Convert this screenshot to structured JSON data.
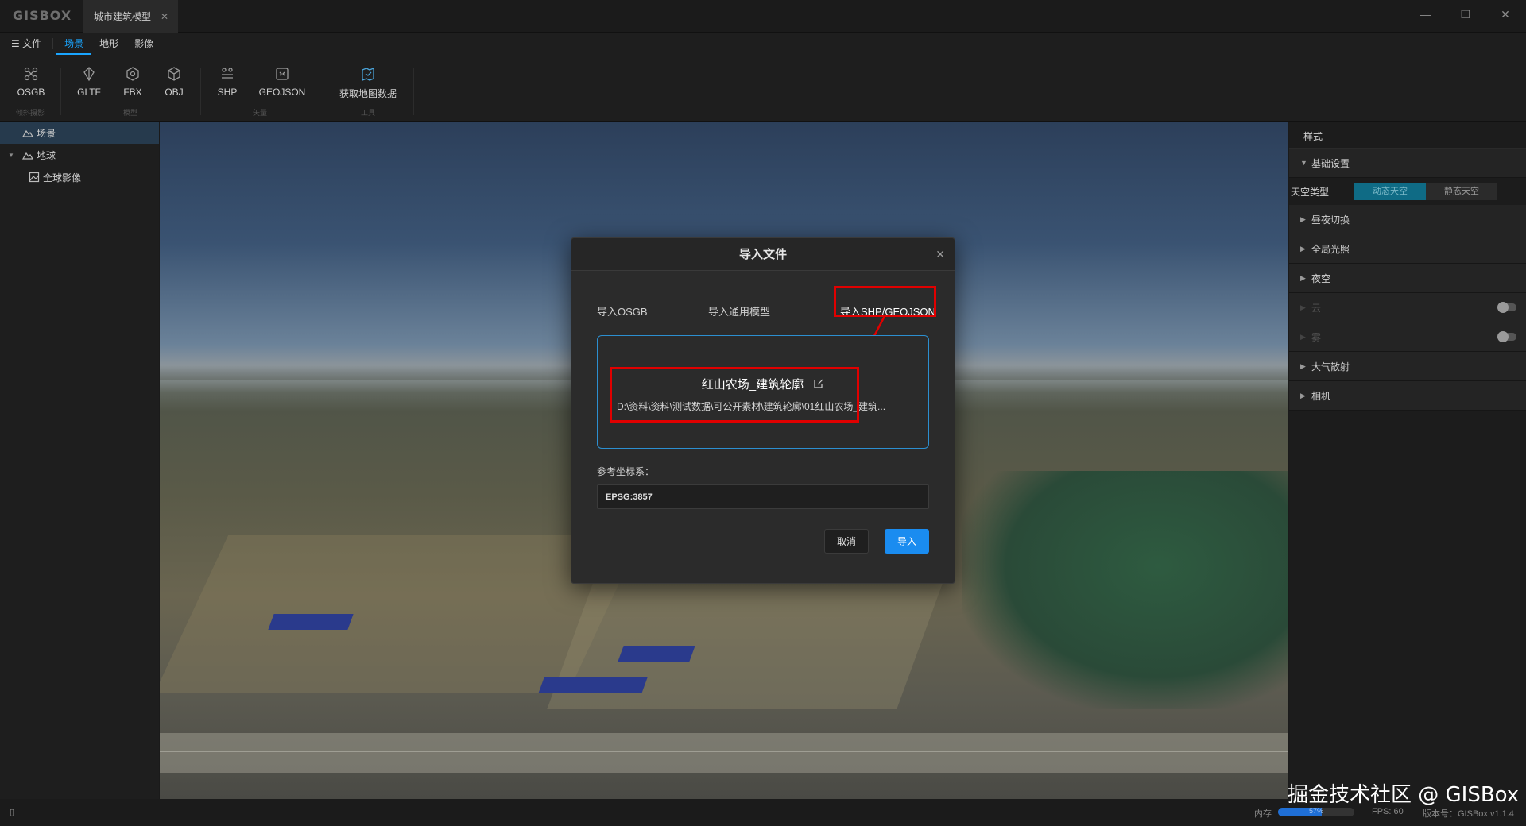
{
  "app": {
    "logo": "GISBOX",
    "document_tab": "城市建筑模型"
  },
  "menu": {
    "file": "文件",
    "tabs": [
      "场景",
      "地形",
      "影像"
    ],
    "active_tab": "场景"
  },
  "ribbon": {
    "buttons": [
      "OSGB",
      "GLTF",
      "FBX",
      "OBJ",
      "SHP",
      "GEOJSON",
      "获取地图数据"
    ],
    "groups": [
      "倾斜摄影",
      "模型",
      "矢量",
      "工具"
    ]
  },
  "tree": {
    "items": [
      "场景",
      "地球",
      "全球影像"
    ]
  },
  "right_panel": {
    "tab": "样式",
    "basic_settings": "基础设置",
    "sky_type_label": "天空类型",
    "sky_options": [
      "动态天空",
      "静态天空"
    ],
    "sky_selected": "动态天空",
    "sections": [
      "昼夜切换",
      "全局光照",
      "夜空",
      "云",
      "雾",
      "大气散射",
      "相机"
    ],
    "toggles": {
      "云": false,
      "雾": false
    }
  },
  "dialog": {
    "title": "导入文件",
    "tabs": [
      "导入OSGB",
      "导入通用模型",
      "导入SHP/GEOJSON"
    ],
    "active_tab": "导入SHP/GEOJSON",
    "file_name": "红山农场_建筑轮廓",
    "file_path": "D:\\资料\\资料\\测试数据\\可公开素材\\建筑轮廓\\01红山农场_建筑...",
    "crs_label": "参考坐标系：",
    "crs_value": "EPSG:3857",
    "cancel": "取消",
    "import": "导入"
  },
  "status": {
    "memory_label": "内存",
    "memory_percent": "57%",
    "memory_fraction": 0.57,
    "fps": "FPS: 60",
    "version": "版本号：GISBox v1.1.4"
  },
  "watermark": "掘金技术社区 @ GISBox",
  "colors": {
    "accent": "#1aa5ff",
    "highlight": "#e00000",
    "primary_button": "#1a8cf0"
  }
}
